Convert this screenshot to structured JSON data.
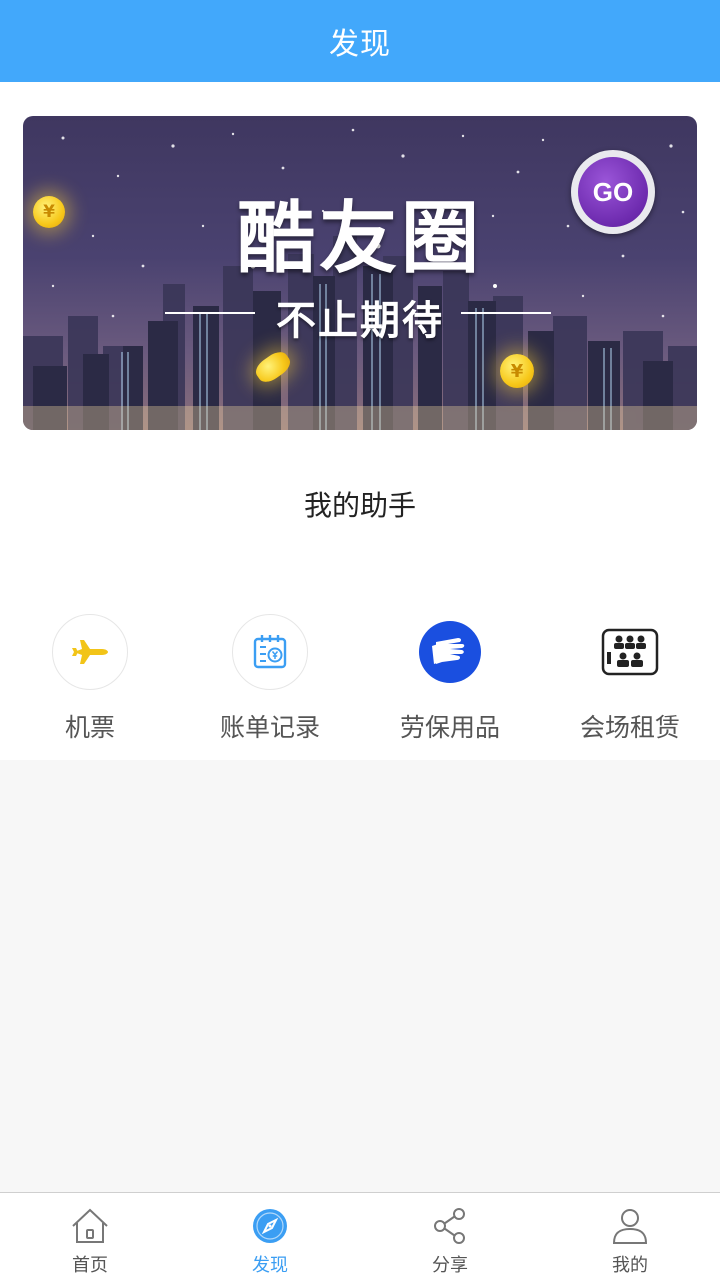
{
  "header": {
    "title": "发现"
  },
  "banner": {
    "title": "酷友圈",
    "subtitle": "不止期待",
    "go_label": "GO",
    "coin_symbol": "¥"
  },
  "assistant": {
    "title": "我的助手",
    "items": [
      {
        "label": "机票",
        "icon": "airplane-icon",
        "color": "#f2c418"
      },
      {
        "label": "账单记录",
        "icon": "bill-icon",
        "color": "#3b9ef3"
      },
      {
        "label": "劳保用品",
        "icon": "gloves-icon",
        "color": "#1a4fe0"
      },
      {
        "label": "会场租赁",
        "icon": "venue-icon",
        "color": "#222222"
      }
    ]
  },
  "bottom_nav": {
    "items": [
      {
        "label": "首页",
        "icon": "home-icon",
        "active": false
      },
      {
        "label": "发现",
        "icon": "compass-icon",
        "active": true
      },
      {
        "label": "分享",
        "icon": "share-icon",
        "active": false
      },
      {
        "label": "我的",
        "icon": "user-icon",
        "active": false
      }
    ]
  },
  "colors": {
    "accent": "#42a8fb",
    "active_nav": "#3b9ef3",
    "background": "#f7f7f7"
  }
}
